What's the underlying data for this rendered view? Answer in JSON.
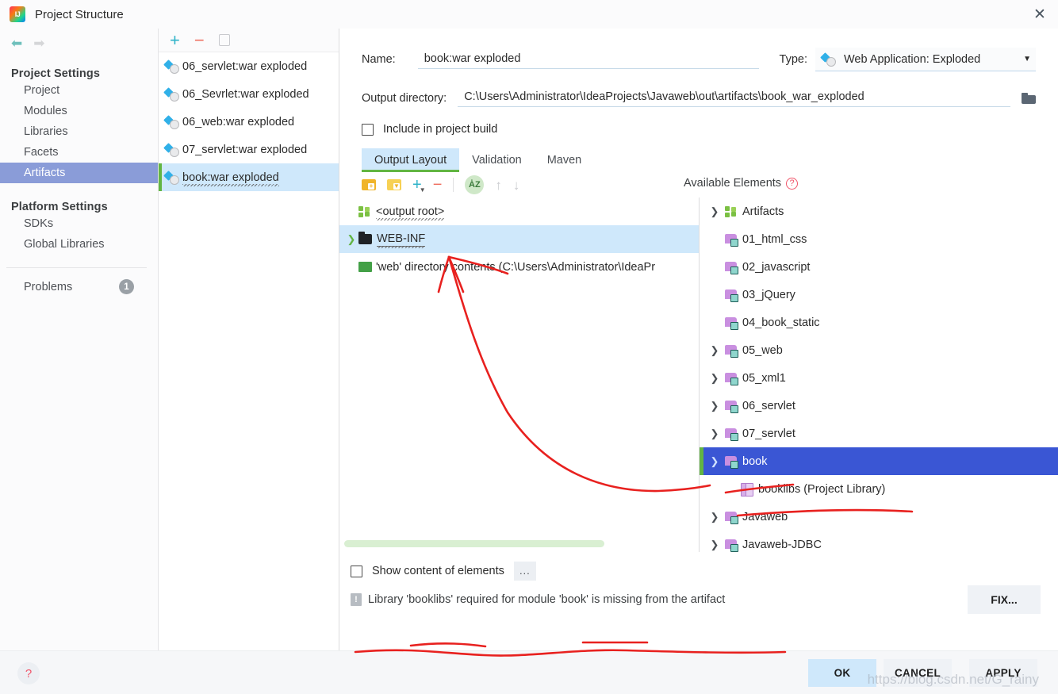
{
  "window": {
    "title": "Project Structure",
    "logo_icon": "intellij-idea-logo",
    "close_icon": "close-icon"
  },
  "sidebar": {
    "back_icon": "arrow-left-icon",
    "forward_icon": "arrow-right-icon",
    "sections": [
      {
        "heading": "Project Settings",
        "items": [
          {
            "label": "Project",
            "selected": false
          },
          {
            "label": "Modules",
            "selected": false
          },
          {
            "label": "Libraries",
            "selected": false
          },
          {
            "label": "Facets",
            "selected": false
          },
          {
            "label": "Artifacts",
            "selected": true
          }
        ]
      },
      {
        "heading": "Platform Settings",
        "items": [
          {
            "label": "SDKs",
            "selected": false
          },
          {
            "label": "Global Libraries",
            "selected": false
          }
        ]
      }
    ],
    "problems": {
      "label": "Problems",
      "count": "1"
    }
  },
  "artifact_list": {
    "toolbar": {
      "add_icon": "plus-icon",
      "remove_icon": "minus-icon",
      "copy_icon": "copy-icon"
    },
    "items": [
      {
        "label": "06_servlet:war exploded",
        "selected": false,
        "warning": false
      },
      {
        "label": "06_Sevrlet:war exploded",
        "selected": false,
        "warning": false
      },
      {
        "label": "06_web:war exploded",
        "selected": false,
        "warning": false
      },
      {
        "label": "07_servlet:war exploded",
        "selected": false,
        "warning": false
      },
      {
        "label": "book:war exploded",
        "selected": true,
        "warning": true
      }
    ]
  },
  "detail": {
    "name_label": "Name:",
    "name_value": "book:war exploded",
    "type_label": "Type:",
    "type_value": "Web Application: Exploded",
    "type_icon": "artifact-icon",
    "type_caret_icon": "chevron-down-icon",
    "output_dir_label": "Output directory:",
    "output_dir_value": "C:\\Users\\Administrator\\IdeaProjects\\Javaweb\\out\\artifacts\\book_war_exploded",
    "browse_icon": "folder-open-icon",
    "include_in_build": {
      "label": "Include in project build",
      "checked": false
    },
    "tabs": [
      {
        "label": "Output Layout",
        "active": true
      },
      {
        "label": "Validation",
        "active": false
      },
      {
        "label": "Maven",
        "active": false
      }
    ],
    "layout_toolbar": {
      "create_directory_icon": "folder-add-icon",
      "create_archive_icon": "folder-archive-icon",
      "add_icon": "plus-dropdown-icon",
      "remove_icon": "minus-icon",
      "sort_icon": "sort-az-icon",
      "move_up_icon": "arrow-up-icon",
      "move_down_icon": "arrow-down-icon"
    },
    "output_tree": [
      {
        "label": "<output root>",
        "icon": "artifacts-icon",
        "indent": 0,
        "chevron": "none",
        "selected": false,
        "squiggle": true
      },
      {
        "label": "WEB-INF",
        "icon": "folder-black-icon",
        "indent": 0,
        "chevron": "right",
        "selected": true,
        "squiggle": true
      },
      {
        "label": "'web' directory contents (C:\\Users\\Administrator\\IdeaPr",
        "icon": "folder-green-icon",
        "indent": 1,
        "chevron": "none",
        "selected": false,
        "squiggle": false
      }
    ],
    "available_elements": {
      "title": "Available Elements",
      "help_icon": "help-icon",
      "items": [
        {
          "label": "Artifacts",
          "icon": "artifacts-icon",
          "indent": 0,
          "chevron": "right",
          "selected": false
        },
        {
          "label": "01_html_css",
          "icon": "module-icon",
          "indent": 0,
          "chevron": "none",
          "selected": false
        },
        {
          "label": "02_javascript",
          "icon": "module-icon",
          "indent": 0,
          "chevron": "none",
          "selected": false
        },
        {
          "label": "03_jQuery",
          "icon": "module-icon",
          "indent": 0,
          "chevron": "none",
          "selected": false
        },
        {
          "label": "04_book_static",
          "icon": "module-icon",
          "indent": 0,
          "chevron": "none",
          "selected": false
        },
        {
          "label": "05_web",
          "icon": "module-icon",
          "indent": 0,
          "chevron": "right",
          "selected": false
        },
        {
          "label": "05_xml1",
          "icon": "module-icon",
          "indent": 0,
          "chevron": "right",
          "selected": false
        },
        {
          "label": "06_servlet",
          "icon": "module-icon",
          "indent": 0,
          "chevron": "right",
          "selected": false
        },
        {
          "label": "07_servlet",
          "icon": "module-icon",
          "indent": 0,
          "chevron": "right",
          "selected": false
        },
        {
          "label": "book",
          "icon": "module-icon",
          "indent": 0,
          "chevron": "down",
          "selected": true
        },
        {
          "label": "booklibs (Project Library)",
          "icon": "library-icon",
          "indent": 1,
          "chevron": "none",
          "selected": false
        },
        {
          "label": "Javaweb",
          "icon": "module-icon",
          "indent": 0,
          "chevron": "right",
          "selected": false
        },
        {
          "label": "Javaweb-JDBC",
          "icon": "module-icon",
          "indent": 0,
          "chevron": "right",
          "selected": false
        }
      ]
    },
    "show_content": {
      "label": "Show content of elements",
      "checked": false,
      "more_label": "..."
    },
    "error": {
      "icon": "warning-icon",
      "message": "Library 'booklibs' required for module 'book' is missing from the artifact",
      "fix_label": "FIX..."
    }
  },
  "footer": {
    "help_icon": "help-icon",
    "buttons": [
      {
        "label": "OK",
        "primary": true
      },
      {
        "label": "CANCEL",
        "primary": false
      },
      {
        "label": "APPLY",
        "primary": false
      }
    ]
  },
  "watermark": "https://blog.csdn.net/G_rainy",
  "colors": {
    "accent_selection_blue": "#3a56d4",
    "light_selection": "#cfe8fb",
    "sidebar_selection": "#8a9cd8",
    "green_marker": "#62b543",
    "annotation_red": "#e8211f"
  }
}
